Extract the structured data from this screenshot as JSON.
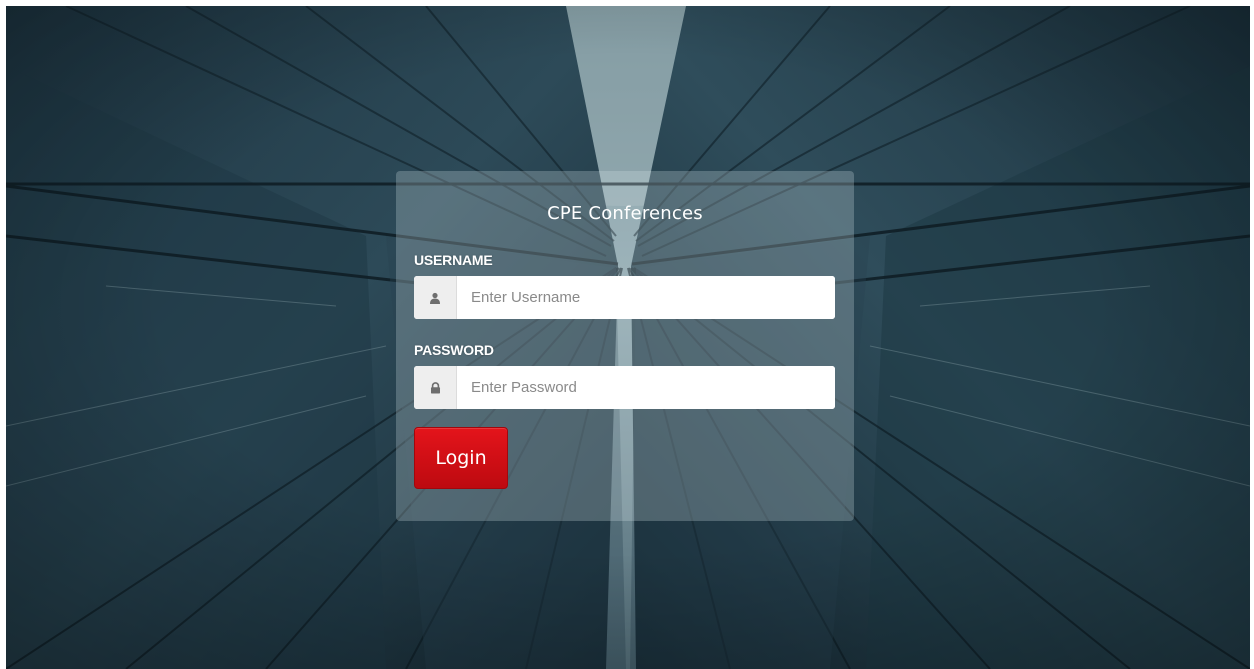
{
  "app": {
    "title": "CPE Conferences"
  },
  "form": {
    "username": {
      "label": "USERNAME",
      "placeholder": "Enter Username",
      "value": "",
      "icon": "user-icon"
    },
    "password": {
      "label": "PASSWORD",
      "placeholder": "Enter Password",
      "value": "",
      "icon": "lock-icon"
    },
    "submit_label": "Login"
  },
  "colors": {
    "button_red": "#d40f16",
    "background_teal": "#2e4a57"
  }
}
